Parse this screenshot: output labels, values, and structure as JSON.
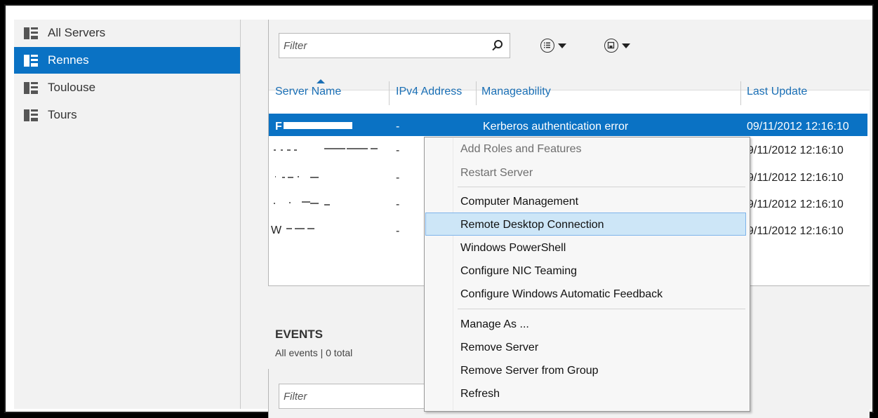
{
  "sidebar": {
    "items": [
      {
        "label": "All Servers",
        "selected": false
      },
      {
        "label": "Rennes",
        "selected": true
      },
      {
        "label": "Toulouse",
        "selected": false
      },
      {
        "label": "Tours",
        "selected": false
      }
    ]
  },
  "servers": {
    "filter_placeholder": "Filter",
    "columns": [
      "Server Name",
      "IPv4 Address",
      "Manageability",
      "Last Update"
    ],
    "rows": [
      {
        "name": "F",
        "ipv4": "-",
        "manageability": "Kerberos authentication error",
        "last_update": "09/11/2012 12:16:10"
      },
      {
        "name": "",
        "ipv4": "-",
        "manageability": "",
        "last_update": "09/11/2012 12:16:10"
      },
      {
        "name": "",
        "ipv4": "-",
        "manageability": "",
        "last_update": "09/11/2012 12:16:10"
      },
      {
        "name": "",
        "ipv4": "-",
        "manageability": "",
        "last_update": "09/11/2012 12:16:10"
      },
      {
        "name": "W",
        "ipv4": "-",
        "manageability": "",
        "last_update": "09/11/2012 12:16:10"
      }
    ],
    "visible_last_update": [
      "09/11/2012 12:16:10",
      "9/11/2012 12:16:10",
      "9/11/2012 12:16:10",
      "9/11/2012 12:16:10",
      "9/11/2012 12:16:10"
    ]
  },
  "events": {
    "title": "EVENTS",
    "subtitle": "All events | 0 total",
    "filter_placeholder": "Filter"
  },
  "context_menu": {
    "items": [
      {
        "label": "Add Roles and Features",
        "disabled": true
      },
      {
        "label": "Restart Server",
        "disabled": true
      },
      {
        "label": "Computer Management",
        "disabled": false
      },
      {
        "label": "Remote Desktop Connection",
        "disabled": false,
        "highlighted": true
      },
      {
        "label": "Windows PowerShell",
        "disabled": false
      },
      {
        "label": "Configure NIC Teaming",
        "disabled": false
      },
      {
        "label": "Configure Windows Automatic Feedback",
        "disabled": false
      },
      {
        "label": "Manage As ...",
        "disabled": false
      },
      {
        "label": "Remove Server",
        "disabled": false
      },
      {
        "label": "Remove Server from Group",
        "disabled": false
      },
      {
        "label": "Refresh",
        "disabled": false
      }
    ]
  },
  "colors": {
    "accent": "#0a72c4",
    "menu_highlight": "#cde6f7",
    "header_link": "#1a6fb5"
  }
}
